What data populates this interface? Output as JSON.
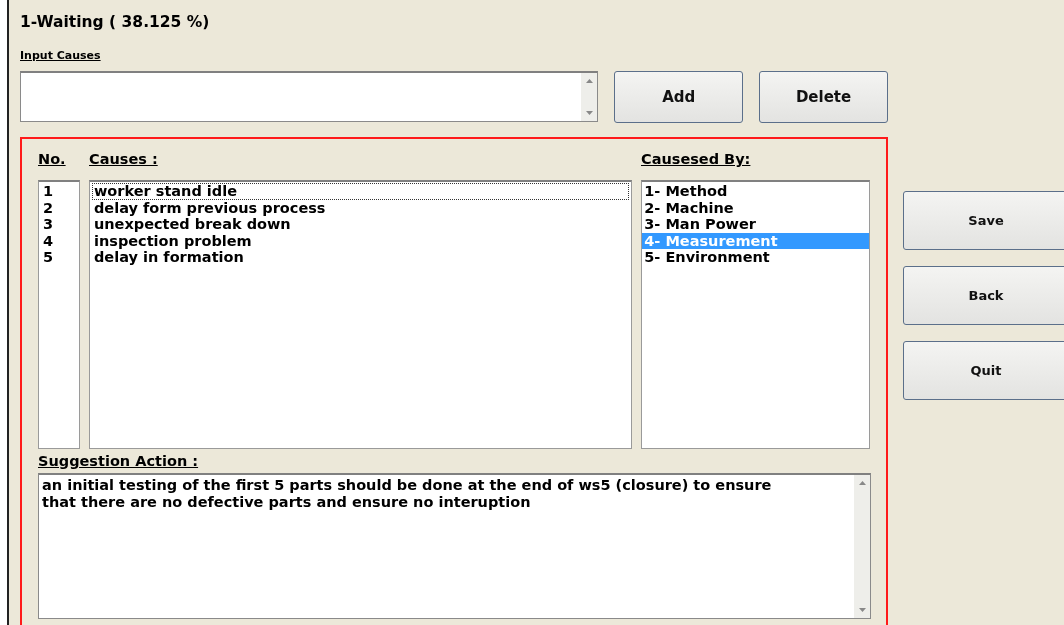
{
  "title": "1-Waiting ( 38.125 %)",
  "input_causes": {
    "label": "Input Causes",
    "buttons": [
      "Add",
      "Delete"
    ]
  },
  "causes_panel": {
    "no_header": "No.",
    "causes_header": "Causes :",
    "caused_by_header": "Causesed By:",
    "numbers": [
      "1",
      "2",
      "3",
      "4",
      "5"
    ],
    "causes": [
      {
        "text": "worker stand idle",
        "focused": true
      },
      {
        "text": "delay form previous process",
        "focused": false
      },
      {
        "text": "unexpected break down",
        "focused": false
      },
      {
        "text": "inspection problem",
        "focused": false
      },
      {
        "text": "delay in formation",
        "focused": false
      }
    ],
    "caused_by": [
      {
        "text": "1- Method",
        "selected": false
      },
      {
        "text": "2- Machine",
        "selected": false
      },
      {
        "text": "3- Man Power",
        "selected": false
      },
      {
        "text": "4- Measurement",
        "selected": true
      },
      {
        "text": "5- Environment",
        "selected": false
      }
    ],
    "suggestion_label": "Suggestion Action :",
    "suggestion": "an initial testing of the first 5 parts should be done at the end of ws5 (closure) to ensure that there are no defective parts and ensure no interuption"
  },
  "side_buttons": [
    "Save",
    "Back",
    "Quit"
  ]
}
